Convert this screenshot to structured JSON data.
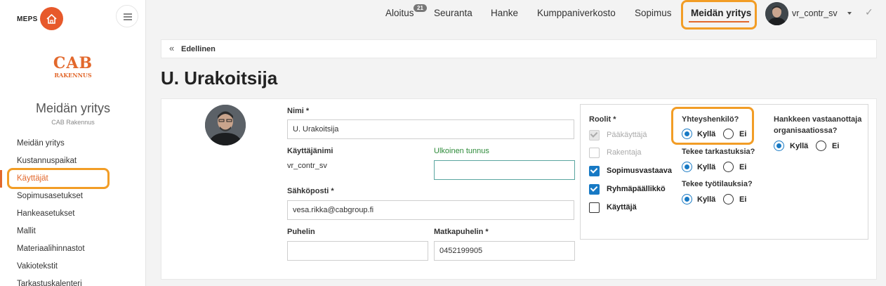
{
  "sidebar": {
    "brand": "MEPS",
    "logo_big": "CAB",
    "logo_small": "RAKENNUS",
    "company_title": "Meidän yritys",
    "company_sub": "CAB Rakennus",
    "items": [
      {
        "label": "Meidän yritys"
      },
      {
        "label": "Kustannuspaikat"
      },
      {
        "label": "Käyttäjät"
      },
      {
        "label": "Sopimusasetukset"
      },
      {
        "label": "Hankeasetukset"
      },
      {
        "label": "Mallit"
      },
      {
        "label": "Materiaalihinnastot"
      },
      {
        "label": "Vakiotekstit"
      },
      {
        "label": "Tarkastuskalenteri"
      }
    ],
    "active_index": 2
  },
  "topnav": {
    "items": [
      {
        "label": "Aloitus"
      },
      {
        "label": "Seuranta"
      },
      {
        "label": "Hanke"
      },
      {
        "label": "Kumppaniverkosto"
      },
      {
        "label": "Sopimus"
      },
      {
        "label": "Meidän yritys"
      }
    ],
    "badge": "21",
    "active": "Meidän yritys",
    "username": "vr_contr_sv"
  },
  "back_label": "Edellinen",
  "page_title": "U. Urakoitsija",
  "form": {
    "name_label": "Nimi *",
    "name_value": "U. Urakoitsija",
    "username_label": "Käyttäjänimi",
    "username_value": "vr_contr_sv",
    "external_label": "Ulkoinen tunnus",
    "external_value": "",
    "email_label": "Sähköposti *",
    "email_value": "vesa.rikka@cabgroup.fi",
    "phone_label": "Puhelin",
    "phone_value": "",
    "mobile_label": "Matkapuhelin *",
    "mobile_value": "0452199905"
  },
  "roles": {
    "label": "Roolit *",
    "items": [
      {
        "label": "Pääkäyttäjä",
        "checked": true,
        "disabled": true
      },
      {
        "label": "Rakentaja",
        "checked": false,
        "disabled": true
      },
      {
        "label": "Sopimusvastaava",
        "checked": true,
        "disabled": false
      },
      {
        "label": "Ryhmäpäällikkö",
        "checked": true,
        "disabled": false
      },
      {
        "label": "Käyttäjä",
        "checked": false,
        "disabled": false
      }
    ]
  },
  "questions": {
    "contact": {
      "label": "Yhteyshenkilö?",
      "selected": "Kyllä"
    },
    "inspections": {
      "label": "Tekee tarkastuksia?",
      "selected": "Kyllä"
    },
    "worksite": {
      "label": "Tekee työtilauksia?",
      "selected": "Kyllä"
    },
    "receiver": {
      "label_line1": "Hankkeen vastaanottaja",
      "label_line2": "organisaatiossa?",
      "selected": "Kyllä"
    },
    "yes": "Kyllä",
    "no": "Ei"
  },
  "colors": {
    "accent": "#e2682c",
    "highlight": "#f29d26",
    "primary": "#1779c4",
    "link_green": "#2e8b3a"
  }
}
